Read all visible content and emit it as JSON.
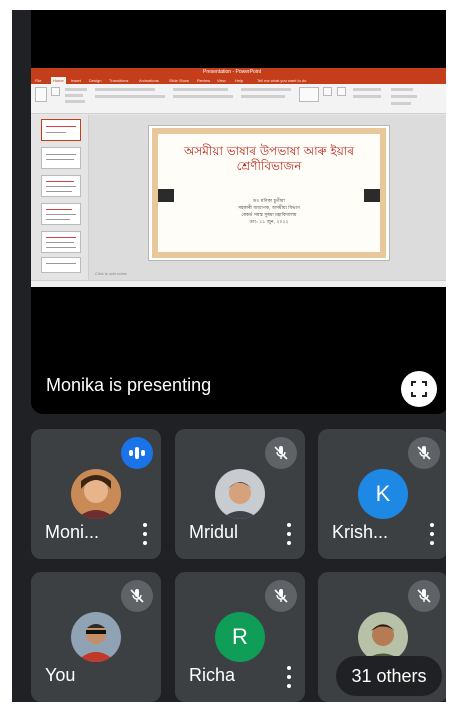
{
  "presentation": {
    "window_title": "Presentation - PowerPoint",
    "tabs": [
      "File",
      "Home",
      "Insert",
      "Design",
      "Transitions",
      "Animations",
      "Slide Show",
      "Review",
      "View",
      "Help",
      "Tell me what you want to do"
    ],
    "notes_hint": "Click to add notes",
    "slide": {
      "title_line1": "অসমীয়া ভাষাৰ উপভাষা আৰু ইয়াৰ",
      "title_line2": "শ্ৰেণীবিভাজন",
      "sub_line1": "ড০ মণিকা চুতীয়া",
      "sub_line2": "সহকাৰী অধ্যাপক, অসমীয়া বিভাগ",
      "sub_line3": "ৰেকৰ্ড সমস্ত সুৰমা মহাবিদ্যালয়",
      "sub_line4": "তাং: ১১ জুন, ২০২২"
    }
  },
  "presenting_label": "Monika is presenting",
  "fullscreen_icon": "fullscreen-icon",
  "participants": [
    {
      "name": "Moni...",
      "status": "speaking",
      "avatar": "photo",
      "color": "#1a73e8"
    },
    {
      "name": "Mridul",
      "status": "muted",
      "avatar": "photo"
    },
    {
      "name": "Krish...",
      "status": "muted",
      "avatar": "letter",
      "letter": "K",
      "color": "#1e88e5"
    },
    {
      "name": "You",
      "status": "muted",
      "avatar": "photo"
    },
    {
      "name": "Richa",
      "status": "muted",
      "avatar": "letter",
      "letter": "R",
      "color": "#0f9d58"
    },
    {
      "name": "",
      "status": "muted",
      "avatar": "photo"
    }
  ],
  "others_label": "31 others",
  "colors": {
    "tile_bg": "#3c4043",
    "app_bg": "#202124",
    "mute_bg": "#5f6368",
    "speaking": "#1a73e8",
    "ppt_red": "#c43e1c"
  }
}
